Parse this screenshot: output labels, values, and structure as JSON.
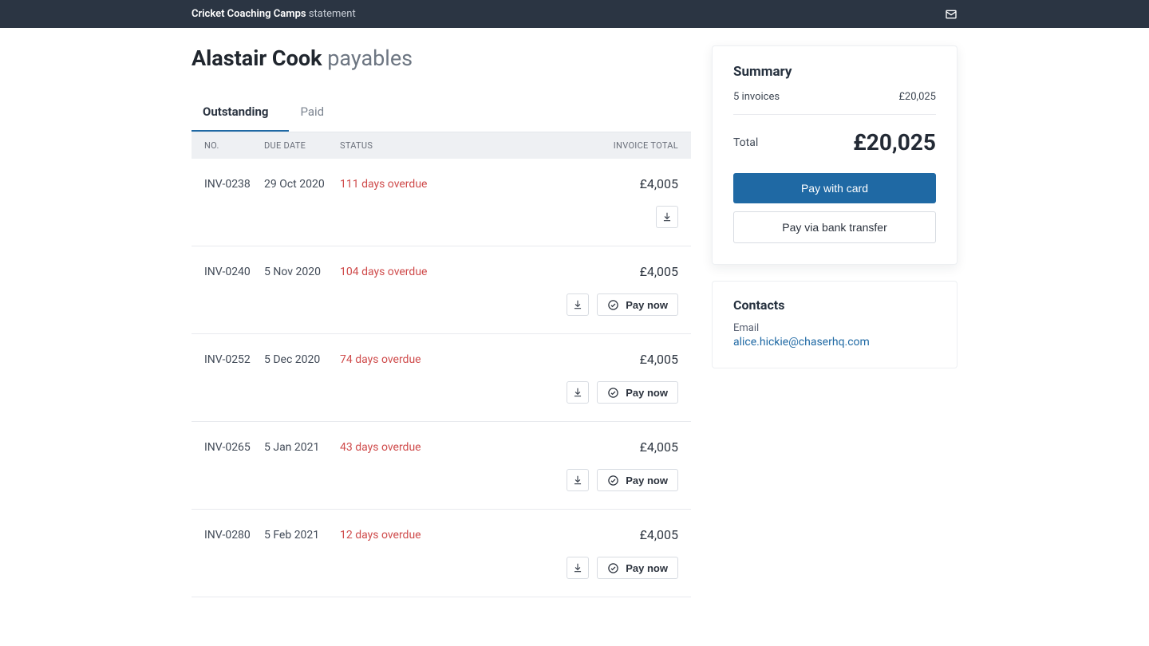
{
  "header": {
    "org": "Cricket Coaching Camps",
    "suffix": "statement"
  },
  "title": {
    "name": "Alastair Cook",
    "suffix": "payables"
  },
  "tabs": {
    "outstanding": "Outstanding",
    "paid": "Paid"
  },
  "columns": {
    "no": "NO.",
    "due": "DUE DATE",
    "status": "STATUS",
    "total": "INVOICE TOTAL"
  },
  "pay_now_label": "Pay now",
  "invoices": [
    {
      "no": "INV-0238",
      "due": "29 Oct 2020",
      "status": "111 days overdue",
      "total": "£4,005",
      "pay_now": false
    },
    {
      "no": "INV-0240",
      "due": "5 Nov 2020",
      "status": "104 days overdue",
      "total": "£4,005",
      "pay_now": true
    },
    {
      "no": "INV-0252",
      "due": "5 Dec 2020",
      "status": "74 days overdue",
      "total": "£4,005",
      "pay_now": true
    },
    {
      "no": "INV-0265",
      "due": "5 Jan 2021",
      "status": "43 days overdue",
      "total": "£4,005",
      "pay_now": true
    },
    {
      "no": "INV-0280",
      "due": "5 Feb 2021",
      "status": "12 days overdue",
      "total": "£4,005",
      "pay_now": true
    }
  ],
  "summary": {
    "title": "Summary",
    "count_label": "5 invoices",
    "count_amount": "£20,025",
    "total_label": "Total",
    "total_amount": "£20,025",
    "pay_card": "Pay with card",
    "pay_bank": "Pay via bank transfer"
  },
  "contacts": {
    "title": "Contacts",
    "email_label": "Email",
    "email": "alice.hickie@chaserhq.com"
  }
}
